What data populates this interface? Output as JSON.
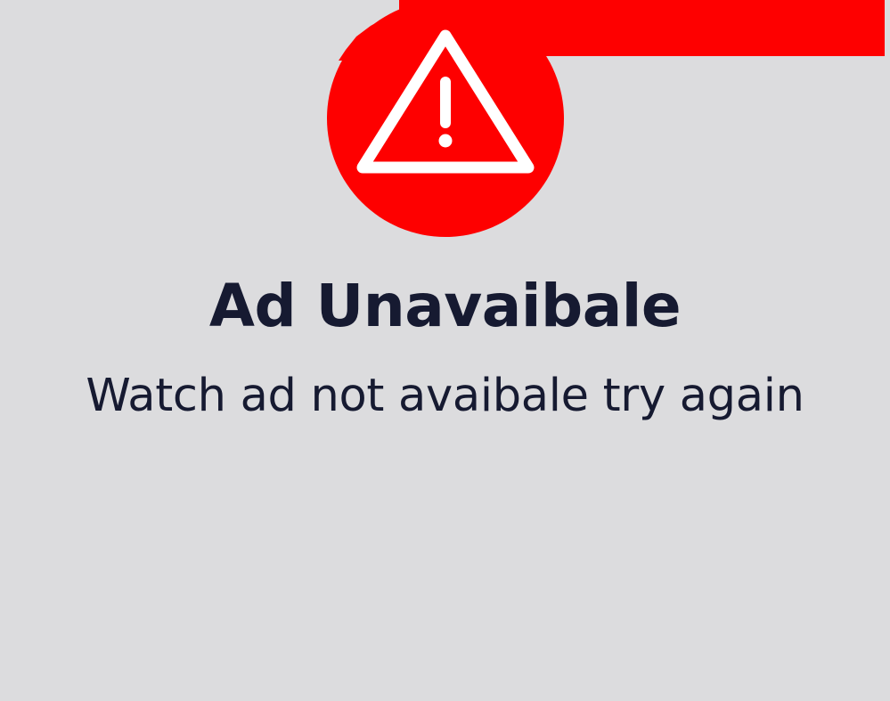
{
  "dialog": {
    "title": "Ad Unavaibale",
    "message": "Watch ad not avaibale try again",
    "icon": "warning-triangle-icon"
  },
  "colors": {
    "background": "#dcdcde",
    "accent": "#fe0000",
    "text": "#161a31",
    "icon_fg": "#ffffff"
  }
}
